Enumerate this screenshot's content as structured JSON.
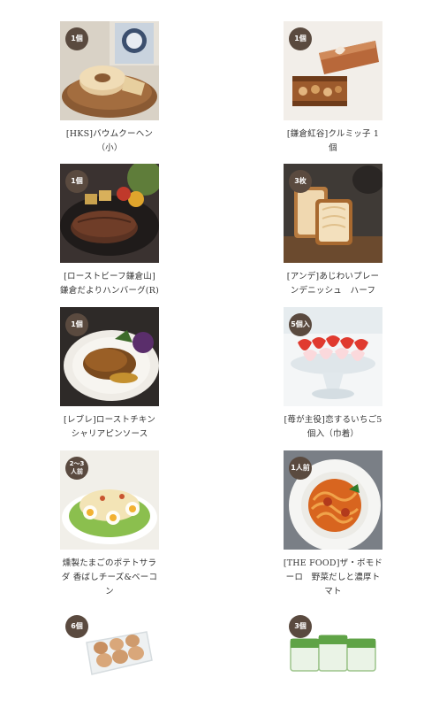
{
  "products": [
    {
      "badge": "1個",
      "name_lines": [
        "[HKS]バウムクーヘン",
        "（小）"
      ],
      "image_icon": "baumkuchen-image"
    },
    {
      "badge": "1個",
      "name_lines": [
        "[鎌倉紅谷]クルミッ子 1",
        "個"
      ],
      "image_icon": "kurumikko-image"
    },
    {
      "badge": "1個",
      "name_lines": [
        "[ローストビーフ鎌倉山]",
        "鎌倉だよりハンバーグ(R)"
      ],
      "image_icon": "hamburg-steak-image"
    },
    {
      "badge": "3枚",
      "name_lines": [
        "[アンデ]あじわいプレー",
        "ンデニッシュ　ハーフ"
      ],
      "image_icon": "danish-bread-image"
    },
    {
      "badge": "1個",
      "name_lines": [
        "[レブレ]ローストチキン",
        "シャリアピンソース"
      ],
      "image_icon": "roast-chicken-image"
    },
    {
      "badge": "5個入",
      "name_lines": [
        "[苺が主役]恋するいちご5",
        "個入（巾着）"
      ],
      "image_icon": "strawberry-image"
    },
    {
      "badge_lines": [
        "2〜3",
        "人前"
      ],
      "name_lines": [
        "燻製たまごのポテトサラ",
        "ダ 香ばしチーズ&ベーコ",
        "ン"
      ],
      "image_icon": "potato-salad-image"
    },
    {
      "badge": "1人前",
      "name_lines": [
        "[THE FOOD]ザ・ボモド",
        "ーロ　野菜だしと濃厚ト",
        "マト"
      ],
      "image_icon": "pasta-image"
    },
    {
      "badge": "6個",
      "name_lines": [],
      "image_icon": "eggs-image"
    },
    {
      "badge": "3個",
      "name_lines": [],
      "image_icon": "yogurt-cups-image"
    }
  ],
  "colors": {
    "badge_bg": "#5a4a3f",
    "text": "#333333",
    "background": "#ffffff"
  }
}
